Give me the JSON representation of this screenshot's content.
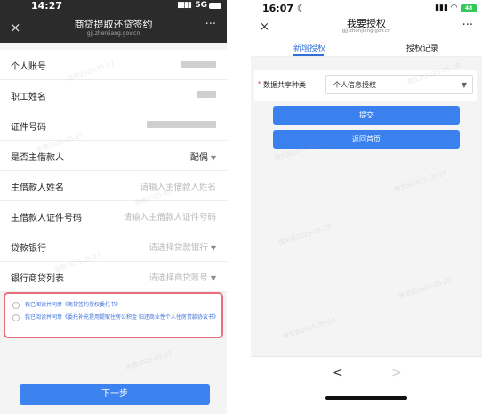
{
  "left": {
    "status": {
      "time": "14:27",
      "signal": "5G"
    },
    "nav": {
      "title": "商贷提取还贷签约",
      "subtitle": "gjj.zhenjiang.gov.cn",
      "close": "×",
      "more": "···"
    },
    "fields": [
      {
        "label": "个人账号",
        "type": "blurred"
      },
      {
        "label": "职工姓名",
        "type": "blurred"
      },
      {
        "label": "证件号码",
        "type": "blurred"
      },
      {
        "label": "是否主借款人",
        "value": "配偶",
        "type": "dropdown"
      },
      {
        "label": "主借款人姓名",
        "placeholder": "请输入主借款人姓名",
        "type": "input"
      },
      {
        "label": "主借款人证件号码",
        "placeholder": "请输入主借款人证件号码",
        "type": "input"
      },
      {
        "label": "贷款银行",
        "placeholder": "请选择贷款银行",
        "type": "dropdown"
      },
      {
        "label": "银行商贷列表",
        "placeholder": "请选择商贷账号",
        "type": "dropdown"
      }
    ],
    "agreements": [
      {
        "text": "我已阅读并同意《商贷签约授权委托书》"
      },
      {
        "text": "我已阅读并同意《委托补充提用提取住房公积金 归还商业性个人住房贷款协议书》"
      }
    ],
    "next_button": "下一步",
    "watermark": "金融2025-05-27"
  },
  "right": {
    "status": {
      "time": "16:07",
      "battery": "48"
    },
    "nav": {
      "title": "我要授权",
      "subtitle": "gjj.zhenjiang.gov.cn",
      "close": "×",
      "more": "···"
    },
    "tabs": [
      {
        "label": "新增授权",
        "active": true
      },
      {
        "label": "授权记录",
        "active": false
      }
    ],
    "field": {
      "required_mark": "*",
      "label": "数据共享种类",
      "value": "个人信息授权"
    },
    "submit_button": "提交",
    "home_button": "返回首页",
    "nav_back": "<",
    "nav_forward": ">",
    "watermark": "微文凯2025-05-28"
  },
  "colors": {
    "accent": "#3c83f0",
    "highlight_border": "#e8707e",
    "link": "#3a6fd8",
    "active_tab": "#2f6fd6"
  }
}
